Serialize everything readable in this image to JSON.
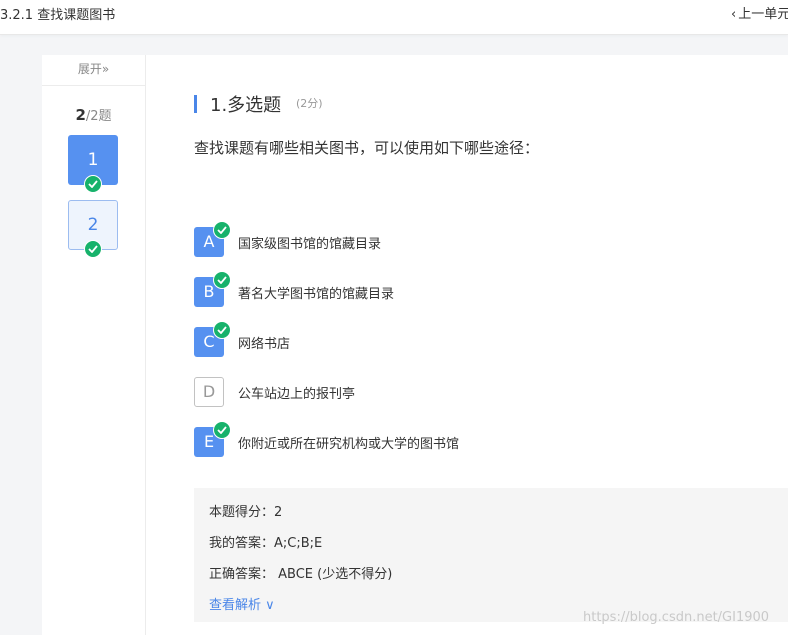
{
  "header": {
    "breadcrumb": "3.2.1 查找课题图书",
    "prev_label": "上一单元"
  },
  "sidebar": {
    "expand_label": "展开»",
    "progress_current": "2",
    "progress_total": "/2题",
    "questions": [
      {
        "label": "1",
        "state": "current",
        "answered": true
      },
      {
        "label": "2",
        "state": "other",
        "answered": true
      }
    ]
  },
  "question": {
    "title": "1.多选题",
    "score": "(2分)",
    "stem": "查找课题有哪些相关图书，可以使用如下哪些途径：",
    "options": [
      {
        "letter": "A",
        "text": "国家级图书馆的馆藏目录",
        "selected": true
      },
      {
        "letter": "B",
        "text": "著名大学图书馆的馆藏目录",
        "selected": true
      },
      {
        "letter": "C",
        "text": "网络书店",
        "selected": true
      },
      {
        "letter": "D",
        "text": "公车站边上的报刊亭",
        "selected": false
      },
      {
        "letter": "E",
        "text": "你附近或所在研究机构或大学的图书馆",
        "selected": true
      }
    ]
  },
  "result": {
    "score_text": "本题得分：2",
    "my_answer_text": "我的答案：A;C;B;E",
    "correct_answer_text": "正确答案：  ABCE (少选不得分)",
    "view_analysis_label": "查看解析 ∨"
  },
  "watermark": "https://blog.csdn.net/GI1900",
  "colors": {
    "accent": "#5691f0",
    "check_green": "#17b26b",
    "link_blue": "#4a86e8"
  },
  "icons": {
    "back": "chevron-left-icon",
    "answered": "check-circle-icon"
  }
}
